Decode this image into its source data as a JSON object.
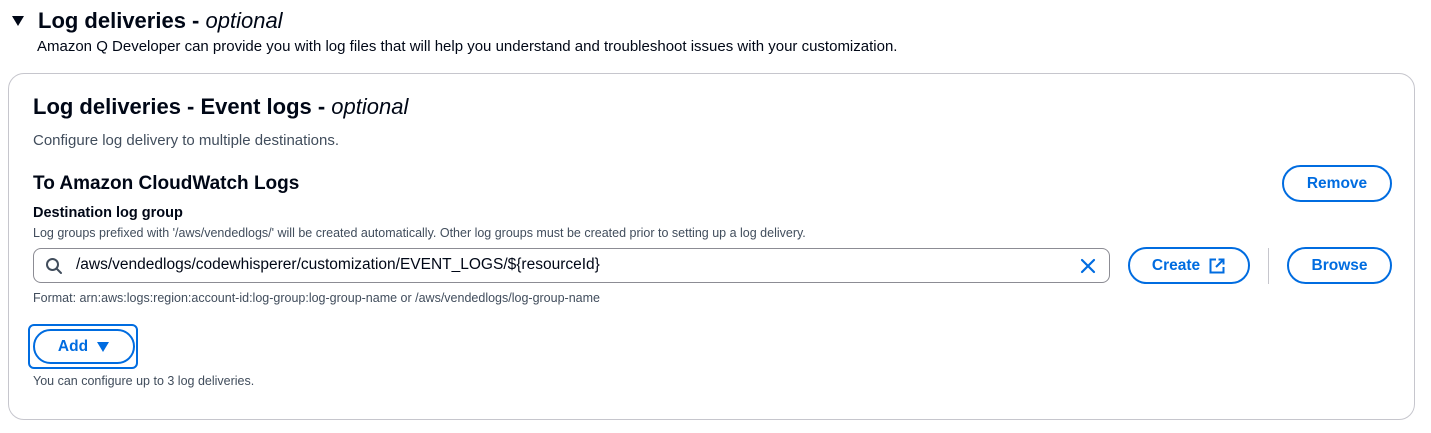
{
  "section": {
    "title": "Log deliveries - ",
    "title_optional": "optional",
    "description": "Amazon Q Developer can provide you with log files that will help you understand and troubleshoot issues with your customization."
  },
  "card": {
    "title": "Log deliveries - Event logs - ",
    "title_optional": "optional",
    "description": "Configure log delivery to multiple destinations.",
    "destination_heading": "To Amazon CloudWatch Logs",
    "remove_label": "Remove",
    "field_label": "Destination log group",
    "field_description": "Log groups prefixed with '/aws/vendedlogs/' will be created automatically. Other log groups must be created prior to setting up a log delivery.",
    "input_value": "/aws/vendedlogs/codewhisperer/customization/EVENT_LOGS/${resourceId}",
    "create_label": "Create",
    "browse_label": "Browse",
    "format_hint": "Format: arn:aws:logs:region:account-id:log-group:log-group-name or /aws/vendedlogs/log-group-name",
    "add_label": "Add",
    "limit_note": "You can configure up to 3 log deliveries."
  },
  "icons": {
    "expand": "caret-down-filled-icon",
    "search": "search-icon",
    "clear": "close-icon",
    "external": "external-link-icon",
    "dropdown": "caret-down-icon"
  },
  "colors": {
    "accent": "#006ce0",
    "text": "#000716",
    "secondary_text": "#414d5c",
    "border": "#c6c6cd"
  }
}
